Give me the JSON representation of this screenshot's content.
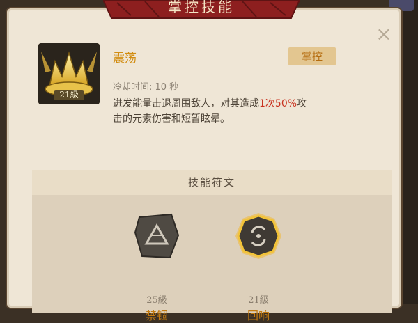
{
  "panel": {
    "title": "掌控技能",
    "close_symbol": "×"
  },
  "skill": {
    "icon": "golden-crown-icon",
    "level": "21級",
    "name": "震荡",
    "tag": "掌控",
    "cooldown": "冷却时间: 10 秒",
    "description": {
      "part1": "迸发能量击退周围敌人，对其造成",
      "count": "1次",
      "percent": "50%",
      "part2": "攻",
      "line2": "击的元素伤害和短暂眩晕。"
    }
  },
  "runes": {
    "header": "技能符文",
    "items": [
      {
        "name": "禁锢",
        "level": "25級",
        "icon": "dark-triangle-rune-icon",
        "selected": false
      },
      {
        "name": "回响",
        "level": "21級",
        "icon": "echo-swirl-rune-icon",
        "selected": true
      }
    ]
  },
  "colors": {
    "accent_gold": "#d28d12",
    "highlight_red": "#c8321f",
    "panel_bg": "#efe6d6",
    "banner_red": "#8d1f1f"
  }
}
